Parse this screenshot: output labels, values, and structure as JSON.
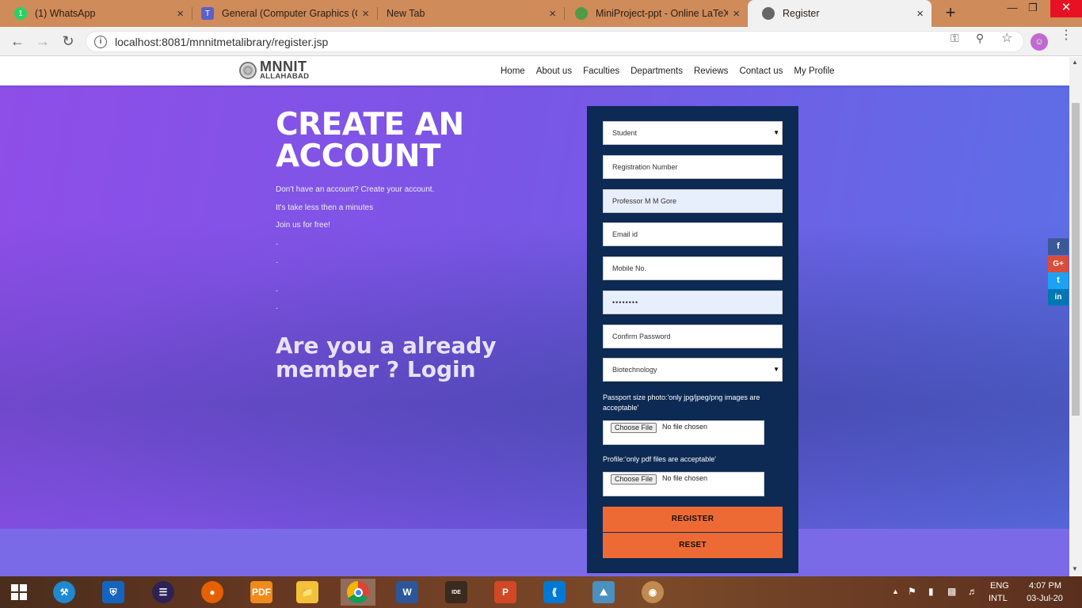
{
  "browser": {
    "tabs": [
      {
        "title": "(1) WhatsApp",
        "icon": "whatsapp-icon",
        "badge": "1"
      },
      {
        "title": "General (Computer Graphics (CS",
        "icon": "teams-icon"
      },
      {
        "title": "New Tab",
        "icon": "none"
      },
      {
        "title": "MiniProject-ppt - Online LaTeX",
        "icon": "overleaf-icon"
      },
      {
        "title": "Register",
        "icon": "globe-icon"
      }
    ],
    "url": "localhost:8081/mnnitmetalibrary/register.jsp",
    "new_tab": "+",
    "close_glyph": "×"
  },
  "site": {
    "logo_line1": "MNNIT",
    "logo_line2": "ALLAHABAD",
    "nav": [
      "Home",
      "About us",
      "Faculties",
      "Departments",
      "Reviews",
      "Contact us",
      "My Profile"
    ]
  },
  "hero": {
    "headline_line1": "CREATE AN",
    "headline_line2": "ACCOUNT",
    "lead1": "Don't have an account? Create your account.",
    "lead2": "It's take less then a minutes",
    "lead3": "Join us for free!",
    "dash": "-",
    "login_text": "Are you a already member ? Login"
  },
  "form": {
    "role_select": "Student",
    "registration": "Registration Number",
    "name_value": "Professor M M Gore",
    "email": "Email id",
    "mobile": "Mobile No.",
    "password_value": "••••••••",
    "confirm_password": "Confirm Password",
    "department_select": "Biotechnology",
    "photo_label": "Passport size photo:'only jpg/jpeg/png images are acceptable'",
    "choose_file": "Choose File",
    "no_file": "No file chosen",
    "profile_label": "Profile:'only pdf files are acceptable'",
    "register_btn": "REGISTER",
    "reset_btn": "RESET"
  },
  "social": [
    {
      "glyph": "f",
      "color": "#3b5998"
    },
    {
      "glyph": "G+",
      "color": "#dd4b39"
    },
    {
      "glyph": "t",
      "color": "#1da1f2"
    },
    {
      "glyph": "in",
      "color": "#0077b5"
    }
  ],
  "taskbar": {
    "lang1": "ENG",
    "lang2": "INTL",
    "time": "4:07 PM",
    "date": "03-Jul-20"
  },
  "colors": {
    "form_bg": "#0c2a53",
    "button": "#ee6a35",
    "hero_start": "#8e4ee8",
    "hero_end": "#5b70e6"
  }
}
